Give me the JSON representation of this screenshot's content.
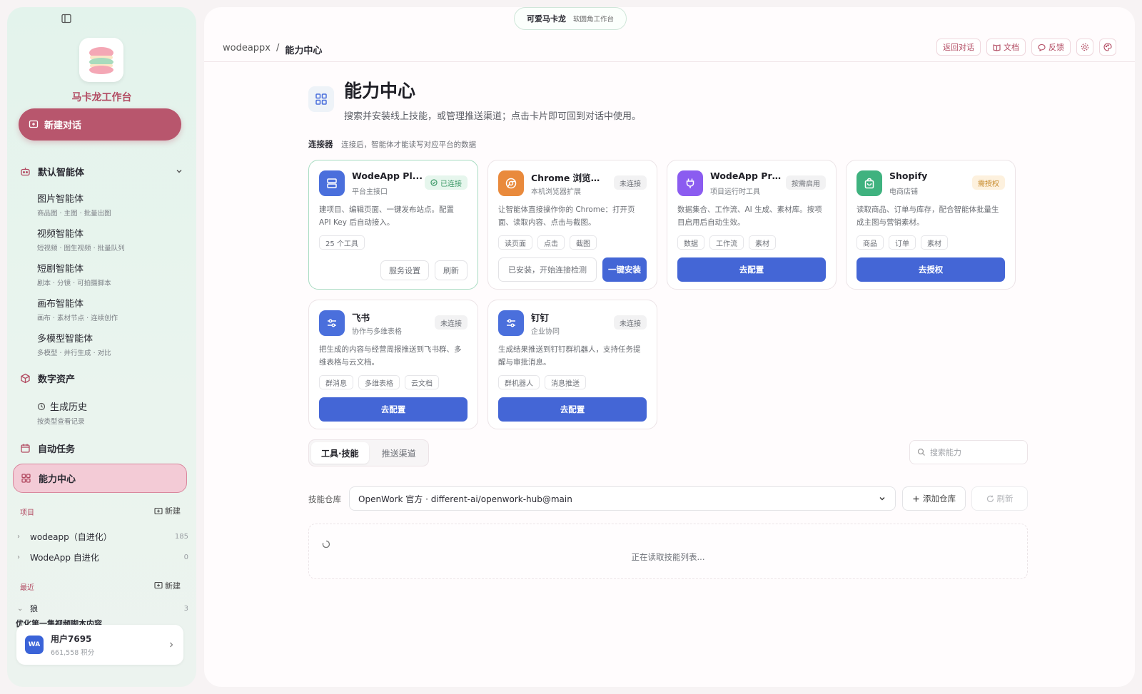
{
  "sidebar": {
    "brand": "马卡龙工作台",
    "new_chat": "新建对话",
    "default_agents": "默认智能体",
    "agents": [
      {
        "title": "图片智能体",
        "sub": "商品图 · 主图 · 批量出图"
      },
      {
        "title": "视频智能体",
        "sub": "短视频 · 图生视频 · 批量队列"
      },
      {
        "title": "短剧智能体",
        "sub": "剧本 · 分镜 · 可拍摄脚本"
      },
      {
        "title": "画布智能体",
        "sub": "画布 · 素材节点 · 连续创作"
      },
      {
        "title": "多模型智能体",
        "sub": "多模型 · 并行生成 · 对比"
      }
    ],
    "digital_assets": "数字资产",
    "history": {
      "title": "生成历史",
      "sub": "按类型查看记录"
    },
    "auto_tasks": "自动任务",
    "capability_center": "能力中心",
    "projects_label": "项目",
    "new_label": "新建",
    "projects": [
      {
        "name": "wodeapp（自进化）",
        "count": "185"
      },
      {
        "name": "WodeApp 自进化",
        "count": "0"
      }
    ],
    "recent_label": "最近",
    "recent_group": {
      "name": "狼",
      "count": "3"
    },
    "recent_item": "优化第一集视频脚本内容",
    "user": {
      "avatar": "WA",
      "name": "用户7695",
      "points": "661,558 积分"
    }
  },
  "topbar": {
    "pill_title": "可爱马卡龙",
    "pill_sub": "软圆角工作台",
    "breadcrumb_root": "wodeappx",
    "breadcrumb_sep": "/",
    "breadcrumb_current": "能力中心",
    "back": "返回对话",
    "docs": "文档",
    "feedback": "反馈"
  },
  "page": {
    "title": "能力中心",
    "subtitle": "搜索并安装线上技能，或管理推送渠道；点击卡片即可回到对话中使用。",
    "connectors_label": "连接器",
    "connectors_hint": "连接后，智能体才能读写对应平台的数据"
  },
  "cards": [
    {
      "name": "WodeApp Pl...",
      "sub": "平台主接口",
      "badge": "已连接",
      "desc": "建项目、编辑页面、一键发布站点。配置 API Key 后自动接入。",
      "tags": [
        "25 个工具"
      ],
      "btn1": "服务设置",
      "btn2": "刷新",
      "color": "#4a6fdc"
    },
    {
      "name": "Chrome 浏览器...",
      "sub": "本机浏览器扩展",
      "badge": "未连接",
      "desc": "让智能体直接操作你的 Chrome：打开页面、读取内容、点击与截图。",
      "tags": [
        "读页面",
        "点击",
        "截图"
      ],
      "btn1": "已安装，开始连接检测",
      "btn2": "一键安装",
      "color": "#e98a3c"
    },
    {
      "name": "WodeApp Pro...",
      "sub": "项目运行时工具",
      "badge": "按需启用",
      "desc": "数据集合、工作流、AI 生成、素材库。按项目启用后自动生效。",
      "tags": [
        "数据",
        "工作流",
        "素材"
      ],
      "btn": "去配置",
      "color": "#8b5cf0"
    },
    {
      "name": "Shopify",
      "sub": "电商店铺",
      "badge": "需授权",
      "desc": "读取商品、订单与库存，配合智能体批量生成主图与营销素材。",
      "tags": [
        "商品",
        "订单",
        "素材"
      ],
      "btn": "去授权",
      "color": "#3fb27f"
    },
    {
      "name": "飞书",
      "sub": "协作与多维表格",
      "badge": "未连接",
      "desc": "把生成的内容与经营周报推送到飞书群、多维表格与云文档。",
      "tags": [
        "群消息",
        "多维表格",
        "云文档"
      ],
      "btn": "去配置",
      "color": "#4a6fdc"
    },
    {
      "name": "钉钉",
      "sub": "企业协同",
      "badge": "未连接",
      "desc": "生成结果推送到钉钉群机器人，支持任务提醒与审批消息。",
      "tags": [
        "群机器人",
        "消息推送"
      ],
      "btn": "去配置",
      "color": "#4a6fdc"
    }
  ],
  "skills": {
    "tab_tools": "工具·技能",
    "tab_push": "推送渠道",
    "search_placeholder": "搜索能力",
    "repo_label": "技能仓库",
    "repo_value": "OpenWork 官方 · different-ai/openwork-hub@main",
    "add_repo": "添加仓库",
    "refresh": "刷新",
    "loading": "正在读取技能列表..."
  },
  "colors": {
    "accent": "#b8566d",
    "primary": "#4466d6",
    "sidebar_bg": "#e3f3ec"
  }
}
